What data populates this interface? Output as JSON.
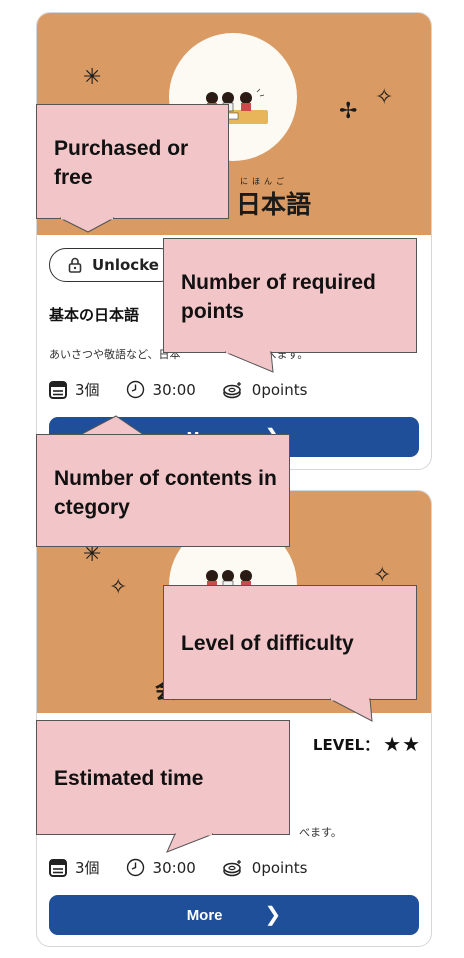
{
  "cards": [
    {
      "banner_title": "日本語",
      "banner_ruby": "にほんご",
      "unlock_label": "Unlocke",
      "title": "基本の日本語",
      "description": "あいさつや敬語など、日本",
      "description_tail": "学べます。",
      "meta": {
        "count": "3個",
        "time": "30:00",
        "points": "0points"
      },
      "more_label": "More"
    },
    {
      "banner_title_partial": "会",
      "level_label": "LEVEL：",
      "level_stars": "★★",
      "level_value": 2,
      "description_tail": "べます。",
      "meta": {
        "count": "3個",
        "time": "30:00",
        "points": "0points"
      },
      "more_label": "More"
    }
  ],
  "callouts": {
    "purchased": "Purchased or free",
    "required_points": "Number of required points",
    "contents": "Number of contents in ctegory",
    "difficulty": "Level of difficulty",
    "estimated_time": "Estimated time"
  },
  "colors": {
    "banner": "#d99a63",
    "button": "#1e4f98",
    "callout": "#f2c6c8"
  }
}
